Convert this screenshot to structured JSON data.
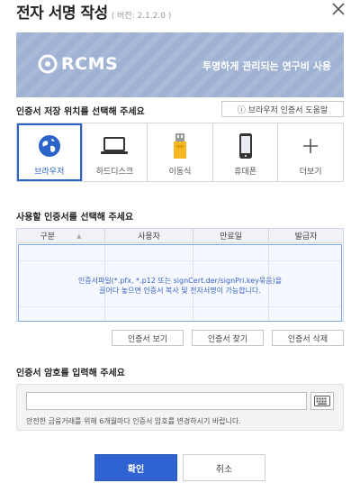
{
  "dialog": {
    "title": "전자 서명 작성",
    "version": "( 버전: 2.1.2.0 )"
  },
  "banner": {
    "logo_text": "RCMS",
    "slogan": "투명하게 관리되는 연구비 사용",
    "color": "#9fb2d4"
  },
  "storage_section": {
    "label": "인증서 저장 위치를 선택해 주세요",
    "help_button": "ⓘ 브라우저 인증서 도움말",
    "items": [
      {
        "label": "브라우저",
        "icon": "globe-icon",
        "selected": true
      },
      {
        "label": "하드디스크",
        "icon": "laptop-icon",
        "selected": false
      },
      {
        "label": "이동식",
        "icon": "usb-drive-icon",
        "selected": false
      },
      {
        "label": "휴대폰",
        "icon": "phone-icon",
        "selected": false
      },
      {
        "label": "더보기",
        "icon": "plus-icon",
        "selected": false
      }
    ]
  },
  "cert_section": {
    "label": "사용할 인증서를 선택해 주세요",
    "columns": [
      "구분",
      "사용자",
      "만료일",
      "발급자"
    ],
    "sort_indicator": "▲",
    "empty_hint_line1": "인증서파일(*.pfx, *.p12 또는 signCert.der/signPri.key묶음)을",
    "empty_hint_line2": "끌어다 놓으면 인증서 복사 및 전자서명이 가능합니다.",
    "buttons": {
      "view": "인증서 보기",
      "find": "인증서 찾기",
      "delete": "인증서 삭제"
    }
  },
  "password_section": {
    "label": "인증서 암호를 입력해 주세요",
    "value": "",
    "note": "안전한 금융거래를 위해 6개월마다 인증서 암호를 변경하시기 바랍니다."
  },
  "actions": {
    "ok": "확인",
    "cancel": "취소"
  },
  "colors": {
    "accent": "#2f63d1",
    "selected_outline": "#2b63c9",
    "hint_text": "#3a63c4"
  }
}
